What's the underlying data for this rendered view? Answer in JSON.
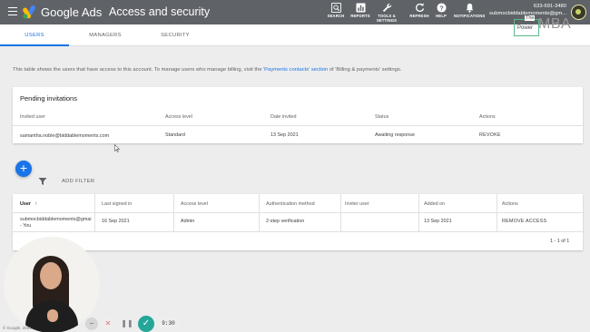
{
  "header": {
    "brand": "Google Ads",
    "title": "Access and security",
    "tools": [
      {
        "label": "SEARCH",
        "icon": "search-icon"
      },
      {
        "label": "REPORTS",
        "icon": "reports-icon"
      },
      {
        "label_line1": "TOOLS &",
        "label_line2": "SETTINGS",
        "icon": "wrench-icon"
      },
      {
        "label": "REFRESH",
        "icon": "refresh-icon"
      },
      {
        "label": "HELP",
        "icon": "help-icon"
      },
      {
        "label": "NOTIFICATIONS",
        "icon": "bell-icon"
      }
    ],
    "account": {
      "id": "633-691-3480",
      "email": "submocbiddablemoments@gm..."
    }
  },
  "tabs": [
    {
      "label": "USERS",
      "active": true
    },
    {
      "label": "MANAGERS",
      "active": false
    },
    {
      "label": "SECURITY",
      "active": false
    }
  ],
  "watermark": {
    "the": "The",
    "power": "Power",
    "mba": "MBA"
  },
  "intro": {
    "before": "This table shows the users that have access to this account. To manage users who manage billing, visit the '",
    "link": "Payments contacts' section",
    "after": " of 'Billing & payments' settings."
  },
  "pending": {
    "title": "Pending invitations",
    "columns": [
      "Invited user",
      "Access level",
      "Date invited",
      "Status",
      "Actions"
    ],
    "rows": [
      {
        "user": "samantha.noble@biddablemoments.com",
        "access": "Standard",
        "date": "13 Sep 2021",
        "status": "Awaiting response",
        "action": "REVOKE"
      }
    ]
  },
  "fab": {
    "label": "+"
  },
  "filter": {
    "label": "ADD FILTER"
  },
  "users": {
    "columns": [
      "User",
      "Last signed in",
      "Access level",
      "Authentication method",
      "Inviter user",
      "Added on",
      "Actions"
    ],
    "rows": [
      {
        "user_line1": "submocbiddablemoments@gmai",
        "user_line2": "- You",
        "last_signed": "16 Sep 2021",
        "access": "Admin",
        "auth": "2-step verification",
        "inviter": "",
        "added": "13 Sep 2021",
        "action": "REMOVE ACCESS"
      }
    ],
    "pagination": "1 - 1 of 1"
  },
  "player": {
    "timer": "9:30",
    "minus": "−",
    "close": "✕",
    "pause": "❚❚",
    "check": "✓"
  },
  "footer": {
    "copyright": "© Google, 2021"
  }
}
